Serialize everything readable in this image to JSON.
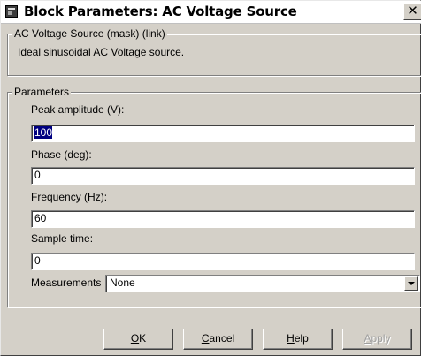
{
  "window": {
    "title": "Block Parameters: AC Voltage Source",
    "close_glyph": "✕"
  },
  "mask_group": {
    "legend": "AC Voltage Source (mask) (link)",
    "description": "Ideal sinusoidal AC Voltage source."
  },
  "params_group": {
    "legend": "Parameters",
    "fields": [
      {
        "label": "Peak amplitude (V):",
        "value": "100"
      },
      {
        "label": "Phase (deg):",
        "value": "0"
      },
      {
        "label": "Frequency (Hz):",
        "value": "60"
      },
      {
        "label": "Sample time:",
        "value": "0"
      }
    ],
    "measurements": {
      "label": "Measurements",
      "value": "None"
    }
  },
  "buttons": {
    "ok": {
      "mn": "O",
      "rest": "K"
    },
    "cancel": {
      "mn": "C",
      "rest": "ancel"
    },
    "help": {
      "mn": "H",
      "rest": "elp"
    },
    "apply": {
      "mn": "A",
      "rest": "pply"
    }
  }
}
